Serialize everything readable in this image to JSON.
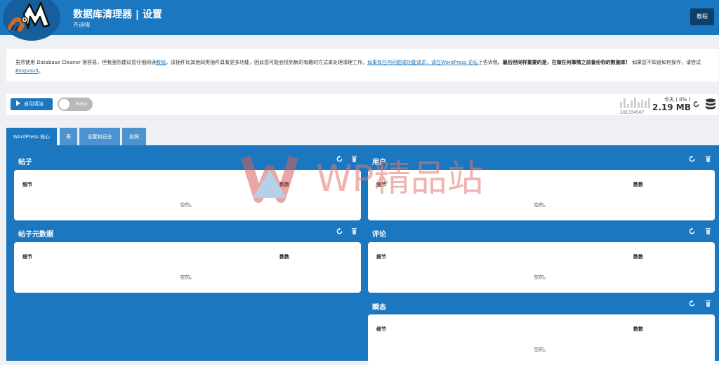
{
  "header": {
    "title": "数据库清理器 | 设置",
    "subtitle": "齐迪嗨",
    "help_label": "教程",
    "logo_icon": "mascot-logo",
    "colors": {
      "primary": "#1a77c0",
      "dark": "#0d3f6b"
    }
  },
  "notice": {
    "t1": "虽然使用 Database Cleaner 很容易，但我强烈建议您仔细阅读",
    "link_tutorial": "教程",
    "t2": "。该插件比其他同类插件具有更多功能，因此您可能会找到新的有趣的方式来处理清理工作。",
    "link_forum": "如果有任何问题或功能请求，请在WordPress 论坛",
    "t3": "上告诉我。",
    "bold": "最后但同样重要的是，在做任何事情之前备份你的数据库！",
    "t4": " 如果您不知道如何操作，请尝试",
    "link_blogvault": "BlogVault",
    "t5": "。"
  },
  "toolbar": {
    "auto_clean_label": "自动清洁",
    "mode_label": "Easy",
    "mini_chart_digits": "101334567",
    "mini_chart_values": [
      0.55,
      0.85,
      0.4,
      0.7,
      0.95,
      0.5,
      0.75,
      0.6,
      0.9
    ],
    "today_label": "今天 ( 0% )",
    "db_size": "2.19 MB",
    "icons": [
      "play-icon",
      "refresh-icon",
      "database-icon"
    ]
  },
  "tabs": [
    {
      "label": "WordPress 核心",
      "active": true
    },
    {
      "label": "表",
      "active": false
    },
    {
      "label": "设置和日志",
      "active": false
    },
    {
      "label": "执照",
      "active": false
    }
  ],
  "sections": {
    "posts": {
      "title": "帖子",
      "col1": "细节",
      "col2": "数数",
      "empty": "空的。"
    },
    "users": {
      "title": "用户",
      "col1": "细节",
      "col2": "数数",
      "empty": "空的。"
    },
    "postmeta": {
      "title": "帖子元数据",
      "col1": "细节",
      "col2": "数数",
      "empty": "空的。"
    },
    "comments": {
      "title": "评论",
      "col1": "细节",
      "col2": "数数",
      "empty": "空的。"
    },
    "transients": {
      "title": "瞬态",
      "col1": "细节",
      "col2": "数数",
      "empty": "空的。"
    }
  },
  "watermark": {
    "text": "WP精品站"
  }
}
